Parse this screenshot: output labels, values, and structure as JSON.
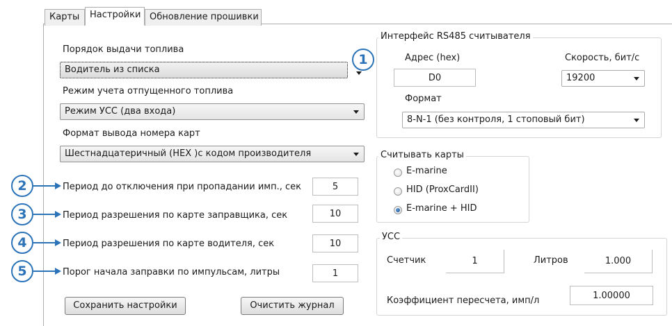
{
  "tabs": [
    {
      "label": "Карты"
    },
    {
      "label": "Настройки"
    },
    {
      "label": "Обновление прошивки"
    }
  ],
  "fuel_order": {
    "label": "Порядок выдачи топлива",
    "value": "Водитель из списка"
  },
  "fuel_accounting": {
    "label": "Режим учета отпущенного топлива",
    "value": "Режим УСС (два входа)"
  },
  "card_format": {
    "label": "Формат вывода номера карт",
    "value": "Шестнадцатеричный (HEX )с кодом производителя"
  },
  "periods": [
    {
      "label": "Период до отключения при пропадании имп., сек",
      "value": "5"
    },
    {
      "label": "Период разрешения по карте заправщика, сек",
      "value": "10"
    },
    {
      "label": "Период разрешения по карте водителя, сек",
      "value": "10"
    },
    {
      "label": "Порог начала заправки по импульсам, литры",
      "value": "1"
    }
  ],
  "buttons": {
    "save": "Сохранить настройки",
    "clear": "Очистить журнал"
  },
  "rs485": {
    "title": "Интерфейс RS485 считывателя",
    "address_label": "Адрес (hex)",
    "address_value": "D0",
    "speed_label": "Скорость, бит/с",
    "speed_value": "19200",
    "format_label": "Формат",
    "format_value": "8-N-1 (без контроля, 1 стоповый бит)"
  },
  "read_cards": {
    "title": "Считывать карты",
    "options": [
      {
        "label": "E-marine",
        "checked": false
      },
      {
        "label": "HID (ProxCardII)",
        "checked": false
      },
      {
        "label": "E-marine + HID",
        "checked": true
      }
    ]
  },
  "uss": {
    "title": "УСС",
    "counter_label": "Счетчик",
    "counter_value": "1",
    "liters_label": "Литров",
    "liters_value": "1.000",
    "coef_label": "Коэффициент пересчета, имп/л",
    "coef_value": "1.00000"
  },
  "callouts": [
    "1",
    "2",
    "3",
    "4",
    "5"
  ],
  "colors": {
    "accent": "#2b73b8"
  }
}
